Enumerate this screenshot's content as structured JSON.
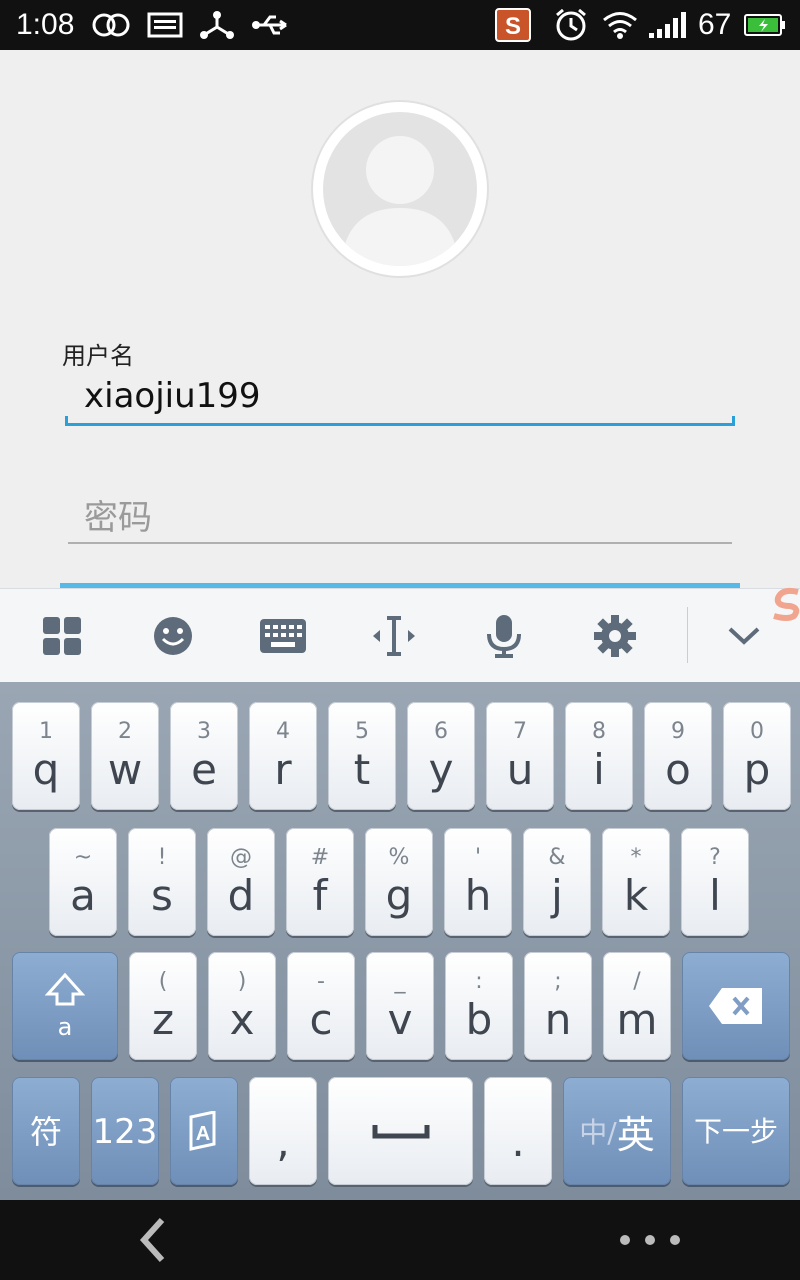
{
  "status_bar": {
    "time": "1:08",
    "battery_percent": "67",
    "icons": [
      "link-icon",
      "keyboard-notification-icon",
      "share-icon",
      "usb-icon",
      "sogou-input-icon",
      "alarm-icon",
      "wifi-icon",
      "signal-icon",
      "battery-icon"
    ]
  },
  "login": {
    "username_label": "用户名",
    "username_value": "xiaojiu199",
    "password_placeholder": "密码"
  },
  "ime_toolbar": {
    "icons": [
      "grid-menu-icon",
      "emoji-icon",
      "keyboard-icon",
      "cursor-icon",
      "microphone-icon",
      "gear-icon",
      "chevron-down-icon"
    ]
  },
  "keyboard": {
    "row1": [
      {
        "sub": "1",
        "main": "q"
      },
      {
        "sub": "2",
        "main": "w"
      },
      {
        "sub": "3",
        "main": "e"
      },
      {
        "sub": "4",
        "main": "r"
      },
      {
        "sub": "5",
        "main": "t"
      },
      {
        "sub": "6",
        "main": "y"
      },
      {
        "sub": "7",
        "main": "u"
      },
      {
        "sub": "8",
        "main": "i"
      },
      {
        "sub": "9",
        "main": "o"
      },
      {
        "sub": "0",
        "main": "p"
      }
    ],
    "row2": [
      {
        "sub": "~",
        "main": "a"
      },
      {
        "sub": "!",
        "main": "s"
      },
      {
        "sub": "@",
        "main": "d"
      },
      {
        "sub": "#",
        "main": "f"
      },
      {
        "sub": "%",
        "main": "g"
      },
      {
        "sub": "'",
        "main": "h"
      },
      {
        "sub": "&",
        "main": "j"
      },
      {
        "sub": "*",
        "main": "k"
      },
      {
        "sub": "?",
        "main": "l"
      }
    ],
    "row3": [
      {
        "sub": "(",
        "main": "z"
      },
      {
        "sub": ")",
        "main": "x"
      },
      {
        "sub": "-",
        "main": "c"
      },
      {
        "sub": "_",
        "main": "v"
      },
      {
        "sub": ":",
        "main": "b"
      },
      {
        "sub": ";",
        "main": "n"
      },
      {
        "sub": "/",
        "main": "m"
      }
    ],
    "shift_sub": "a",
    "symbols_label": "符",
    "numbers_label": "123",
    "comma_label": ",",
    "period_label": ".",
    "lang_zh": "中/",
    "lang_en": "英",
    "next_label": "下一步"
  },
  "colors": {
    "accent": "#2a9fd8",
    "keyboard_bg": "#8a97a6",
    "function_key": "#7f9dc5"
  }
}
